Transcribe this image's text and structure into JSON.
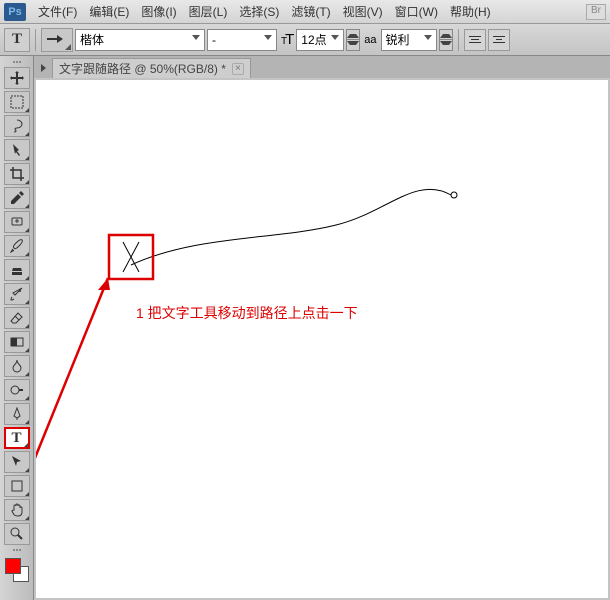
{
  "menu": {
    "items": [
      "文件(F)",
      "编辑(E)",
      "图像(I)",
      "图层(L)",
      "选择(S)",
      "滤镜(T)",
      "视图(V)",
      "窗口(W)",
      "帮助(H)"
    ],
    "br": "Br"
  },
  "options": {
    "font_family": "楷体",
    "font_style": "-",
    "font_size": "12点",
    "aa_label": "aa",
    "aa_mode": "锐利"
  },
  "doc": {
    "tab_title": "文字跟随路径 @ 50%(RGB/8) *"
  },
  "annotation": "1 把文字工具移动到路径上点击一下"
}
